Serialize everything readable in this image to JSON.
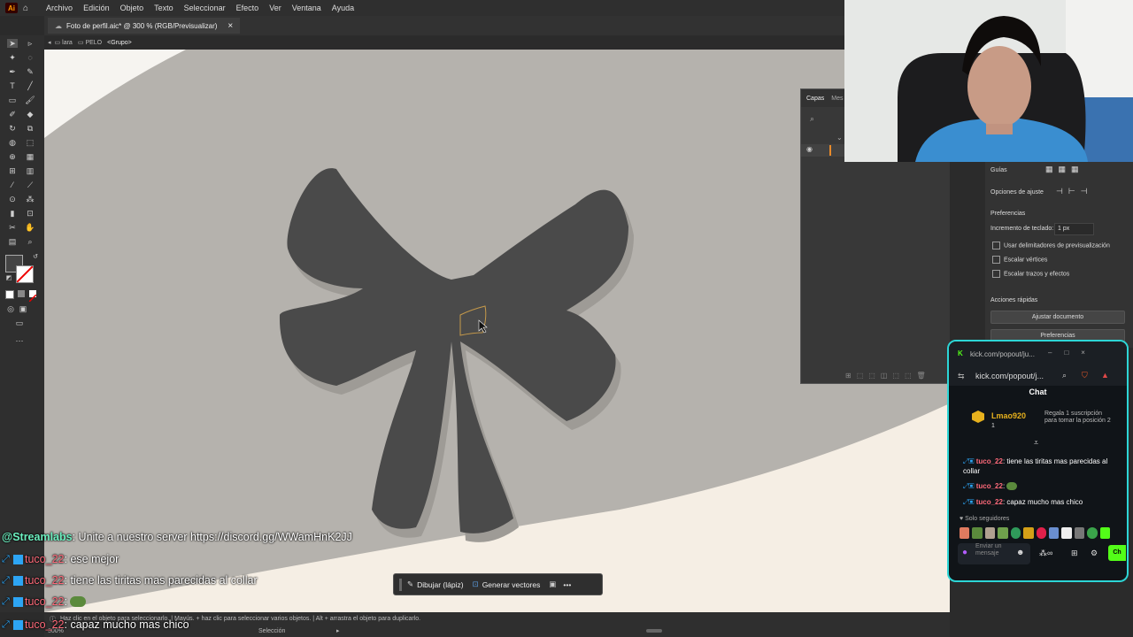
{
  "menu": {
    "app_icon": "Ai",
    "items": [
      "Archivo",
      "Edición",
      "Objeto",
      "Texto",
      "Seleccionar",
      "Efecto",
      "Ver",
      "Ventana",
      "Ayuda"
    ]
  },
  "document_tab": {
    "title": "Foto de perfil.aic* @ 300 % (RGB/Previsualizar)",
    "close": "×"
  },
  "breadcrumb": {
    "layer1": "lara",
    "layer2": "PELO",
    "group": "<Grupo>"
  },
  "layers_panel": {
    "tab1": "Capas",
    "tab2": "Mes"
  },
  "properties": {
    "guides_label": "Guías",
    "snap_label": "Opciones de ajuste",
    "prefs_header": "Preferencias",
    "keyboard_increment_label": "Incremento de teclado:",
    "keyboard_increment_value": "1 px",
    "cb_preview_bounds": "Usar delimitadores de previsualización",
    "cb_scale_corners": "Escalar vértices",
    "cb_scale_strokes": "Escalar trazos y efectos",
    "quick_actions": "Acciones rápidas",
    "fit_document": "Ajustar documento",
    "preferences_button": "Preferencias"
  },
  "floating_toolbar": {
    "draw": "Dibujar (lápiz)",
    "generate": "Generar vectores",
    "more": "•••"
  },
  "status": {
    "zoom": "300%",
    "tool": "Selección",
    "hint": "Haz clic en el objeto para seleccionarlo. | Mayús. + haz clic para seleccionar varios objetos. | Alt + arrastra el objeto para duplicarlo."
  },
  "kick": {
    "window_title": "kick.com/popout/ju...",
    "url": "kick.com/popout/j...",
    "chat_header": "Chat",
    "gift_user": "Lmao920",
    "gift_count": "1",
    "gift_text": "Regala 1 suscripción para tomar la posición 2",
    "messages": [
      {
        "user": "tuco_22",
        "text": "tiene las tiritas mas parecidas al collar"
      },
      {
        "user": "tuco_22",
        "text": ""
      },
      {
        "user": "tuco_22",
        "text": "capaz mucho mas chico"
      }
    ],
    "followers_only": "Solo seguidores",
    "input_placeholder": "Enviar un mensaje",
    "send": "Ch"
  },
  "overlay_chat": [
    {
      "user": "@Streamlabs",
      "text": "Unite a nuestro server https://discord.gg/WWamHnK2JJ"
    },
    {
      "user": "tuco_22",
      "text": "ese mejor"
    },
    {
      "user": "tuco_22",
      "text": "tiene las tiritas mas parecidas al collar"
    },
    {
      "user": "tuco_22",
      "text": ""
    },
    {
      "user": "tuco_22",
      "text": "capaz mucho mas chico"
    }
  ],
  "colors": {
    "bow": "#4a4a4a",
    "canvas": "#b5b2ad",
    "cream": "#f5eee4",
    "kick_green": "#53fc18",
    "overlay_user": "#ff6a7a",
    "streamlabs": "#6cf0c0"
  }
}
